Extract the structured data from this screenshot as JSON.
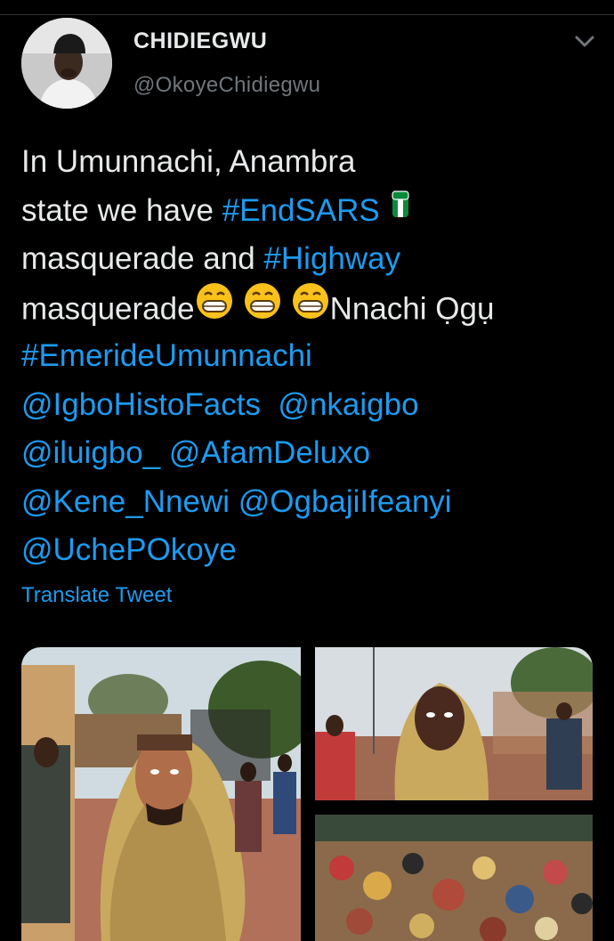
{
  "user": {
    "display_name": "CHIDIEGWU",
    "handle": "@OkoyeChidiegwu"
  },
  "tweet": {
    "line1": "In Umunnachi, Anambra",
    "line2_pre": "state we have ",
    "tag_endsars": "#EndSARS",
    "line3_pre": "masquerade and ",
    "tag_highway": "#Highway",
    "line4_pre": "masquerade",
    "line4_post": "Nnachi Ọgụ",
    "tag_emeride": "#EmerideUmunnachi",
    "mention_1": "@IgboHistoFacts",
    "mention_2": "@nkaigbo",
    "mention_3": "@iluigbo_",
    "mention_4": "@AfamDeluxo",
    "mention_5": "@Kene_Nnewi",
    "mention_6": "@OgbajiIfeanyi",
    "mention_7": "@UchePOkoye"
  },
  "translate_label": "Translate Tweet",
  "icons": {
    "caret": "chevron-down-icon",
    "fist": "raised-fist-emoji",
    "grin": "grinning-face-emoji"
  },
  "colors": {
    "background": "#000000",
    "text": "#e7e9ea",
    "secondary": "#71767b",
    "link": "#1d9bf0"
  }
}
